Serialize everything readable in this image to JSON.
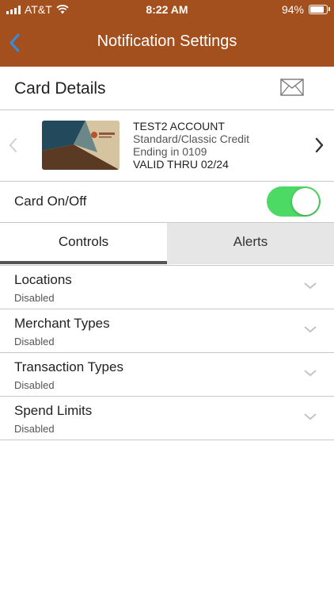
{
  "status_bar": {
    "carrier": "AT&T",
    "time": "8:22 AM",
    "battery": "94%",
    "battery_level": 0.94,
    "icons": [
      "signal-icon",
      "wifi-icon",
      "battery-icon"
    ]
  },
  "nav": {
    "title": "Notification Settings",
    "back_icon": "chevron-left-icon",
    "bar_color": "#a4501e",
    "back_color": "#2e8ee8"
  },
  "card_header": {
    "title": "Card Details",
    "icon": "mail-icon"
  },
  "card": {
    "name": "TEST2 ACCOUNT",
    "type": "Standard/Classic Credit",
    "ending": "Ending in 0109",
    "valid_thru": "VALID THRU 02/24",
    "prev_icon": "chevron-left-icon",
    "next_icon": "chevron-right-icon"
  },
  "card_toggle": {
    "label": "Card On/Off",
    "on": true,
    "color": "#4cd964"
  },
  "tabs": [
    {
      "label": "Controls",
      "selected": true
    },
    {
      "label": "Alerts",
      "selected": false
    }
  ],
  "controls": [
    {
      "name": "Locations",
      "status": "Disabled"
    },
    {
      "name": "Merchant Types",
      "status": "Disabled"
    },
    {
      "name": "Transaction Types",
      "status": "Disabled"
    },
    {
      "name": "Spend Limits",
      "status": "Disabled"
    }
  ]
}
